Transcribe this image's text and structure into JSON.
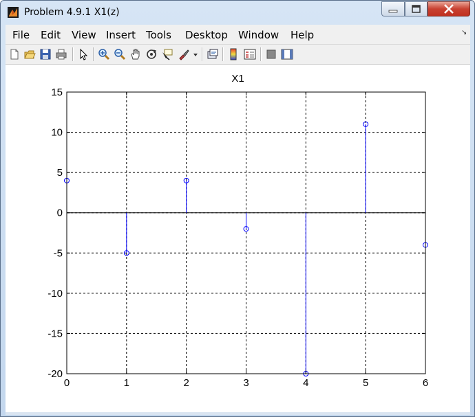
{
  "window": {
    "title": "Problem 4.9.1 X1(z)",
    "icon": "matlab-figure-icon",
    "controls": [
      "minimize-icon",
      "maximize-icon",
      "close-icon"
    ]
  },
  "menu": {
    "items": [
      "File",
      "Edit",
      "View",
      "Insert",
      "Tools",
      "Desktop",
      "Window",
      "Help"
    ]
  },
  "toolbar": {
    "buttons": [
      "new-figure-icon",
      "open-file-icon",
      "save-icon",
      "print-icon",
      "edit-plot-arrow-icon",
      "zoom-in-icon",
      "zoom-out-icon",
      "pan-hand-icon",
      "rotate-3d-icon",
      "data-cursor-icon",
      "brush-icon",
      "link-plot-icon",
      "colorbar-icon",
      "legend-icon",
      "hide-plot-tools-icon",
      "show-plot-tools-icon"
    ]
  },
  "colors": {
    "stem": "#0000ff",
    "grid": "#000000",
    "background": "#ffffff"
  },
  "chart_data": {
    "type": "stem",
    "title": "X1",
    "xlabel": "",
    "ylabel": "",
    "x": [
      0,
      1,
      2,
      3,
      4,
      5,
      6
    ],
    "values": [
      4,
      -5,
      4,
      -2,
      -20,
      11,
      -4
    ],
    "xlim": [
      0,
      6
    ],
    "ylim": [
      -20,
      15
    ],
    "xticks": [
      "0",
      "1",
      "2",
      "3",
      "4",
      "5",
      "6"
    ],
    "yticks": [
      "15",
      "10",
      "5",
      "0",
      "-5",
      "-10",
      "-15",
      "-20"
    ],
    "grid": true,
    "marker": "open-circle"
  }
}
